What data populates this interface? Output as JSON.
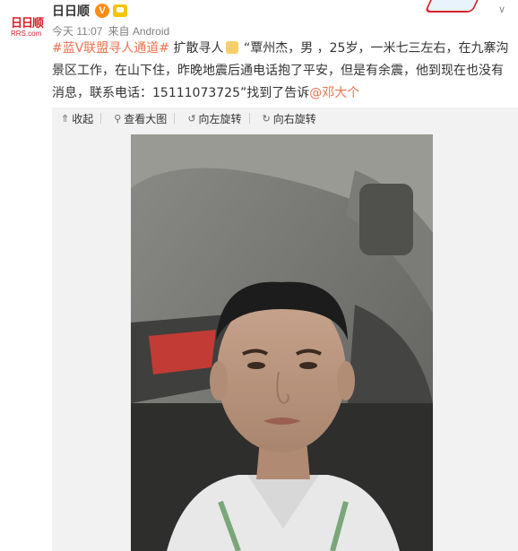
{
  "account": {
    "name": "日日顺",
    "logo_text_top": "日日顺",
    "logo_text_bottom": "RRS.com",
    "verified_badge": "V",
    "member_icon": "crown-icon"
  },
  "meta": {
    "time": "今天 11:07",
    "source": "来自 Android"
  },
  "post": {
    "hashtag": "#蓝V联盟寻人通道#",
    "text_before": " 扩散寻人",
    "text_main": " “覃州杰，男 ，25岁，一米七三左右，在九寨沟景区工作，在山下住，昨晚地震后通电话抱了平安，但是有余震，他到现在也没有消息，联系电话：15111073725”找到了告诉",
    "mention": "@邓大个"
  },
  "media_actions": [
    {
      "icon": "collapse-icon",
      "glyph": "⇑",
      "label": "收起"
    },
    {
      "icon": "search-icon",
      "glyph": "⚲",
      "label": "查看大图"
    },
    {
      "icon": "rotate-left-icon",
      "glyph": "↺",
      "label": "向左旋转"
    },
    {
      "icon": "rotate-right-icon",
      "glyph": "↻",
      "label": "向右旋转"
    }
  ],
  "colors": {
    "accent": "#eb7350",
    "verified": "#ff8c16",
    "brand": "#d71f2a"
  }
}
